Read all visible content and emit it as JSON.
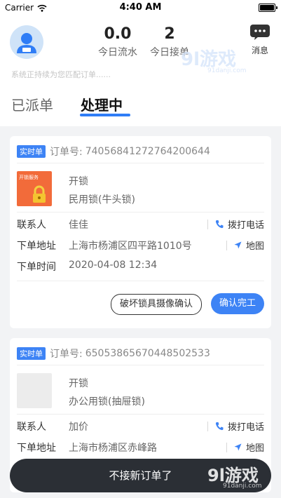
{
  "status_bar": {
    "carrier": "Carrier",
    "time": "4:40 AM"
  },
  "header": {
    "turnover": {
      "value": "0.0",
      "label": "今日流水"
    },
    "orders_taken": {
      "value": "2",
      "label": "今日接单"
    },
    "messages_label": "消息",
    "matching_text": "系统正持续为您匹配订单......"
  },
  "tabs": {
    "dispatched": "已派单",
    "processing": "处理中"
  },
  "labels": {
    "realtime_tag": "实时单",
    "order_no_prefix": "订单号:",
    "contact": "联系人",
    "address": "下单地址",
    "order_time": "下单时间",
    "call": "拨打电话",
    "map": "地图",
    "damage_confirm": "破坏锁具摄像确认",
    "confirm_done": "确认完工"
  },
  "orders": [
    {
      "order_no": "74056841272764200644",
      "service": "开锁",
      "lock_type": "民用锁(牛头锁)",
      "thumb_text": "开锁服务",
      "contact": "佳佳",
      "address": "上海市杨浦区四平路1010号",
      "time": "2020-04-08 12:34"
    },
    {
      "order_no": "65053865670448502533",
      "service": "开锁",
      "lock_type": "办公用锁(抽屉锁)",
      "contact": "加价",
      "address": "上海市杨浦区赤峰路"
    }
  ],
  "stop_orders": "不接新订单了",
  "watermark": {
    "brand": "9l游戏",
    "site": "91danji.com"
  },
  "colors": {
    "accent": "#3d83f5",
    "dark_bar": "#2b2f35",
    "thumb_orange": "#f26b3a"
  }
}
